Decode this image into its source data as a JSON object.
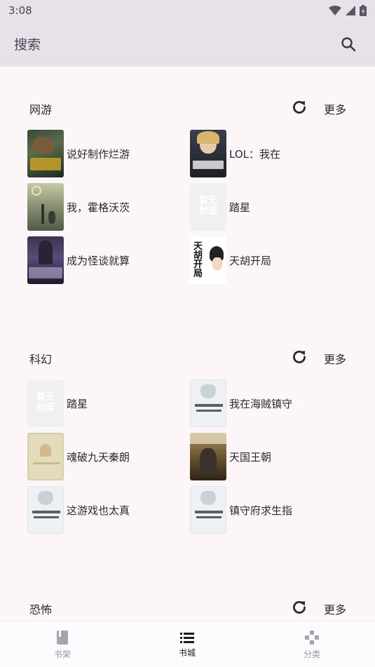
{
  "status": {
    "time": "3:08"
  },
  "appbar": {
    "search_placeholder": "搜索"
  },
  "sections": [
    {
      "title": "网游",
      "more": "更多",
      "books": [
        {
          "title": "说好制作烂游",
          "cover": "dark-art"
        },
        {
          "title": "LOL：我在",
          "cover": "dark-portrait"
        },
        {
          "title": "我，霍格沃茨",
          "cover": "green-art"
        },
        {
          "title": "踏星",
          "cover": "placeholder"
        },
        {
          "title": "成为怪谈就算",
          "cover": "purple-art"
        },
        {
          "title": "天胡开局",
          "cover": "calligraphy"
        }
      ]
    },
    {
      "title": "科幻",
      "more": "更多",
      "books": [
        {
          "title": "踏星",
          "cover": "placeholder"
        },
        {
          "title": "我在海贼镇守",
          "cover": "cat"
        },
        {
          "title": "魂破九天秦朗",
          "cover": "beige"
        },
        {
          "title": "天国王朝",
          "cover": "warrior"
        },
        {
          "title": "这游戏也太真",
          "cover": "cat"
        },
        {
          "title": "镇守府求生指",
          "cover": "cat"
        }
      ]
    },
    {
      "title": "恐怖",
      "more": "更多",
      "books": []
    }
  ],
  "nav": [
    {
      "label": "书架",
      "icon": "book-icon",
      "active": false
    },
    {
      "label": "书城",
      "icon": "list-icon",
      "active": true
    },
    {
      "label": "分类",
      "icon": "category-icon",
      "active": false
    }
  ]
}
